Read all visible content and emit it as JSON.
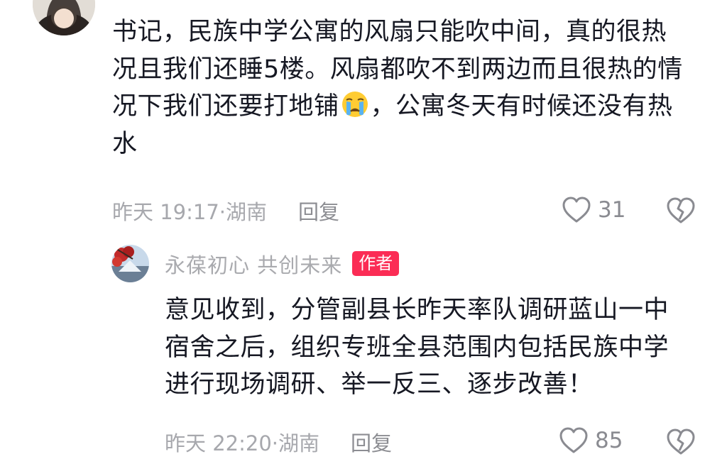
{
  "comment": {
    "text_before_emoji": "书记，民族中学公寓的风扇只能吹中间，真的很热 况且我们还睡5楼。风扇都吹不到两边而且很热的情况下我们还要打地铺",
    "text_after_emoji": "，公寓冬天有时候还没有热水",
    "emoji": "loudly-crying-face",
    "time": "昨天 19:17·湖南",
    "reply_label": "回复",
    "likes": "31"
  },
  "reply": {
    "username": "永葆初心 共创未来",
    "badge": "作者",
    "badge_color": "#fb2c55",
    "text": "意见收到，分管副县长昨天率队调研蓝山一中宿舍之后，组织专班全县范围内包括民族中学进行现场调研、举一反三、逐步改善！",
    "time": "昨天 22:20·湖南",
    "reply_label": "回复",
    "likes": "85"
  },
  "icons": {
    "like": "heart-outline-icon",
    "dislike": "broken-heart-icon"
  }
}
